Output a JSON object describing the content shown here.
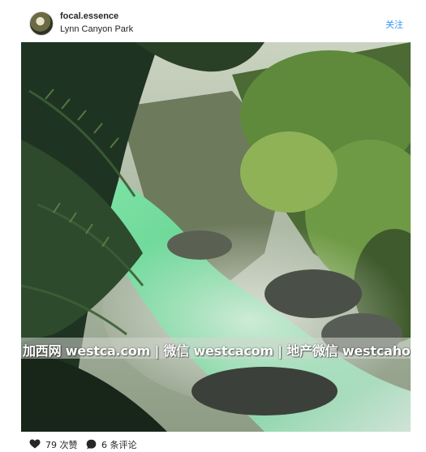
{
  "post": {
    "username": "focal.essence",
    "location": "Lynn Canyon Park",
    "follow_label": "关注"
  },
  "photo": {
    "watermark_text": "加西网 westca.com | 微信 westcacom | 地产微信 westcahouse"
  },
  "stats": {
    "likes_label": "79 次赞",
    "comments_label": "6 条评论"
  },
  "icons": {
    "like": "heart-icon",
    "comment": "comment-bubble-icon"
  },
  "colors": {
    "follow_link": "#3897f0",
    "water_green": "#6fd69a"
  }
}
